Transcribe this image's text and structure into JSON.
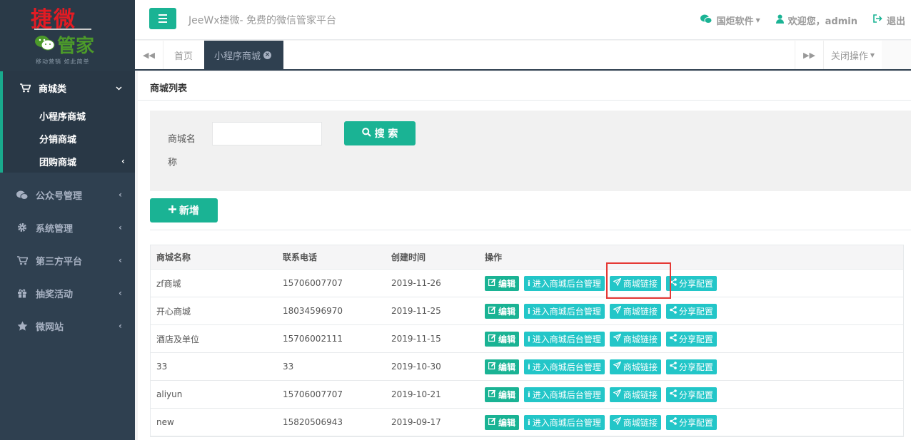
{
  "logo": {
    "top_text": "捷微",
    "mid_text": "管家",
    "slogan": "移动营销 如此简单"
  },
  "sidebar": {
    "items": [
      {
        "label": "商城类",
        "icon": "cart-icon",
        "expanded": true,
        "children": [
          {
            "label": "小程序商城"
          },
          {
            "label": "分销商城"
          },
          {
            "label": "团购商城"
          }
        ]
      },
      {
        "label": "公众号管理",
        "icon": "wechat-icon"
      },
      {
        "label": "系统管理",
        "icon": "gear-icon"
      },
      {
        "label": "第三方平台",
        "icon": "cart-icon"
      },
      {
        "label": "抽奖活动",
        "icon": "gift-icon"
      },
      {
        "label": "微网站",
        "icon": "star-icon"
      }
    ]
  },
  "header": {
    "title": "JeeWx捷微- 免费的微信管家平台",
    "vendor": "国炬软件",
    "welcome": "欢迎您，admin",
    "logout": "退出"
  },
  "tabs": {
    "home": "首页",
    "active": "小程序商城",
    "close_ops": "关闭操作"
  },
  "content": {
    "title": "商城列表",
    "search": {
      "label": "商城名称",
      "button": "搜 索",
      "value": ""
    },
    "add_button": "新增",
    "table": {
      "headers": [
        "商城名称",
        "联系电话",
        "创建时间",
        "操作"
      ],
      "actions": {
        "edit": "编辑",
        "manage": "进入商城后台管理",
        "link": "商城链接",
        "share": "分享配置"
      },
      "rows": [
        {
          "name": "zf商城",
          "phone": "15706007707",
          "date": "2019-11-26"
        },
        {
          "name": "开心商城",
          "phone": "18034596970",
          "date": "2019-11-25"
        },
        {
          "name": "酒店及单位",
          "phone": "15706002111",
          "date": "2019-11-15"
        },
        {
          "name": "33",
          "phone": "33",
          "date": "2019-10-30"
        },
        {
          "name": "aliyun",
          "phone": "15706007707",
          "date": "2019-10-21"
        },
        {
          "name": "new",
          "phone": "15820506943",
          "date": "2019-09-17"
        }
      ]
    }
  },
  "colors": {
    "primary": "#1ab394",
    "info": "#23c6c8",
    "sidebar": "#2f4050",
    "highlight": "#e53935"
  }
}
